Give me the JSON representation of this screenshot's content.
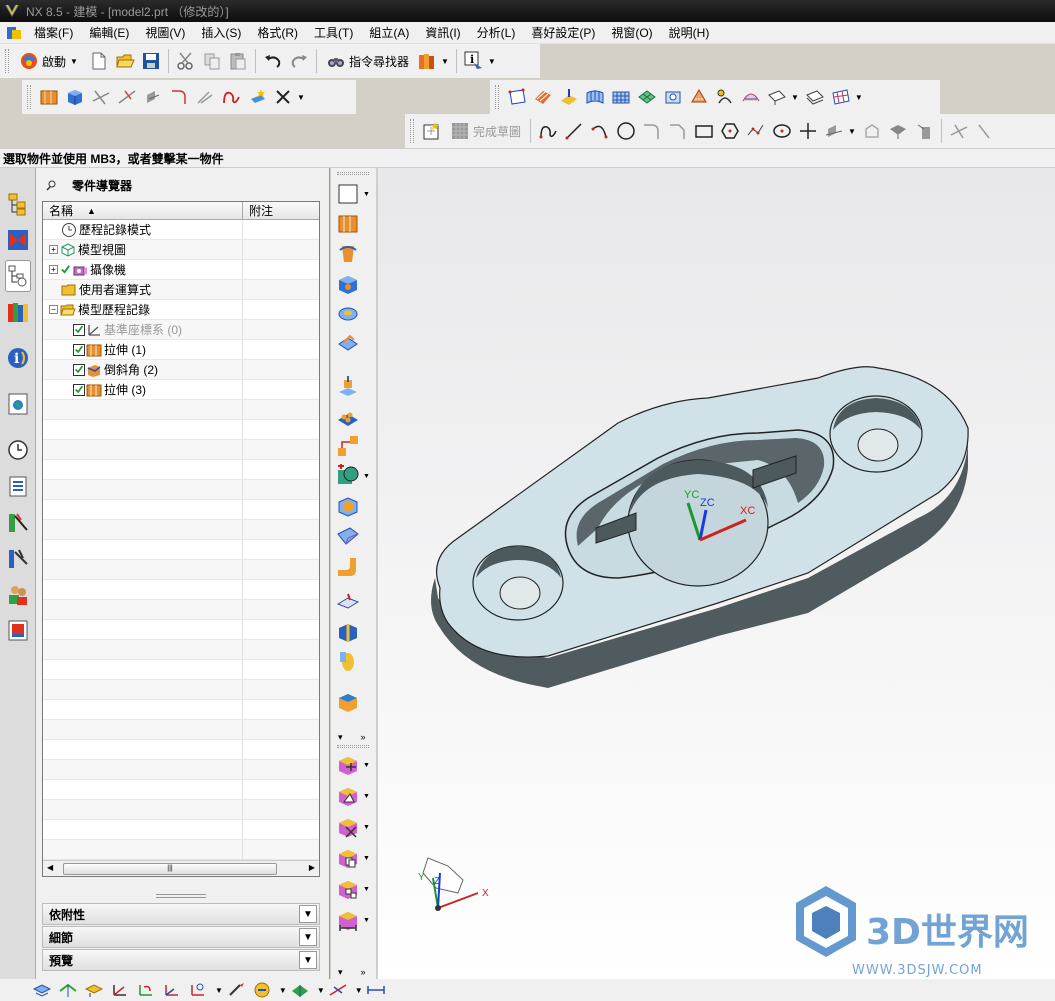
{
  "window": {
    "title": "NX 8.5 - 建模 - [model2.prt （修改的）]"
  },
  "menu": [
    "檔案(F)",
    "編輯(E)",
    "視圖(V)",
    "插入(S)",
    "格式(R)",
    "工具(T)",
    "組立(A)",
    "資訊(I)",
    "分析(L)",
    "喜好設定(P)",
    "視窗(O)",
    "說明(H)"
  ],
  "toolbar": {
    "start_label": "啟動",
    "command_finder_label": "指令尋找器",
    "finish_sketch_label": "完成草圖"
  },
  "prompt": "選取物件並使用 MB3，或者雙擊某一物件",
  "navigator": {
    "title": "零件導覽器",
    "columns": [
      "名稱",
      "附注"
    ],
    "rows": [
      {
        "label": "歷程記錄模式",
        "indent": 1,
        "icon": "clock-icon",
        "expander": "",
        "check": false,
        "grey": false
      },
      {
        "label": "模型視圖",
        "indent": 0,
        "icon": "model-views-icon",
        "expander": "+",
        "check": false,
        "grey": false
      },
      {
        "label": "攝像機",
        "indent": 0,
        "icon": "camera-icon",
        "expander": "+",
        "check": "tick",
        "grey": false
      },
      {
        "label": "使用者運算式",
        "indent": 1,
        "icon": "folder-icon",
        "expander": "",
        "check": false,
        "grey": false
      },
      {
        "label": "模型歷程記錄",
        "indent": 0,
        "icon": "folder-open-icon",
        "expander": "−",
        "check": false,
        "grey": false
      },
      {
        "label": "基準座標系 (0)",
        "indent": 2,
        "icon": "datum-csys-icon",
        "expander": "",
        "check": "box",
        "grey": true
      },
      {
        "label": "拉伸 (1)",
        "indent": 2,
        "icon": "extrude-icon",
        "expander": "",
        "check": "box",
        "grey": false
      },
      {
        "label": "倒斜角 (2)",
        "indent": 2,
        "icon": "chamfer-icon",
        "expander": "",
        "check": "box",
        "grey": false
      },
      {
        "label": "拉伸 (3)",
        "indent": 2,
        "icon": "extrude-icon",
        "expander": "",
        "check": "box",
        "grey": false
      }
    ],
    "empty_rows": 24,
    "sections": [
      "依附性",
      "細節",
      "預覽"
    ]
  },
  "viewport": {
    "csys_labels": {
      "xc": "XC",
      "yc": "YC",
      "zc": "ZC"
    },
    "triad_labels": {
      "x": "X",
      "y": "Y",
      "z": "Z"
    },
    "watermark": {
      "title": "3D世界网",
      "url": "WWW.3DSJW.COM"
    }
  },
  "colors": {
    "part_top": "#d0e2e8",
    "part_side": "#4f5b5e",
    "accent": "#1e7ec8"
  }
}
